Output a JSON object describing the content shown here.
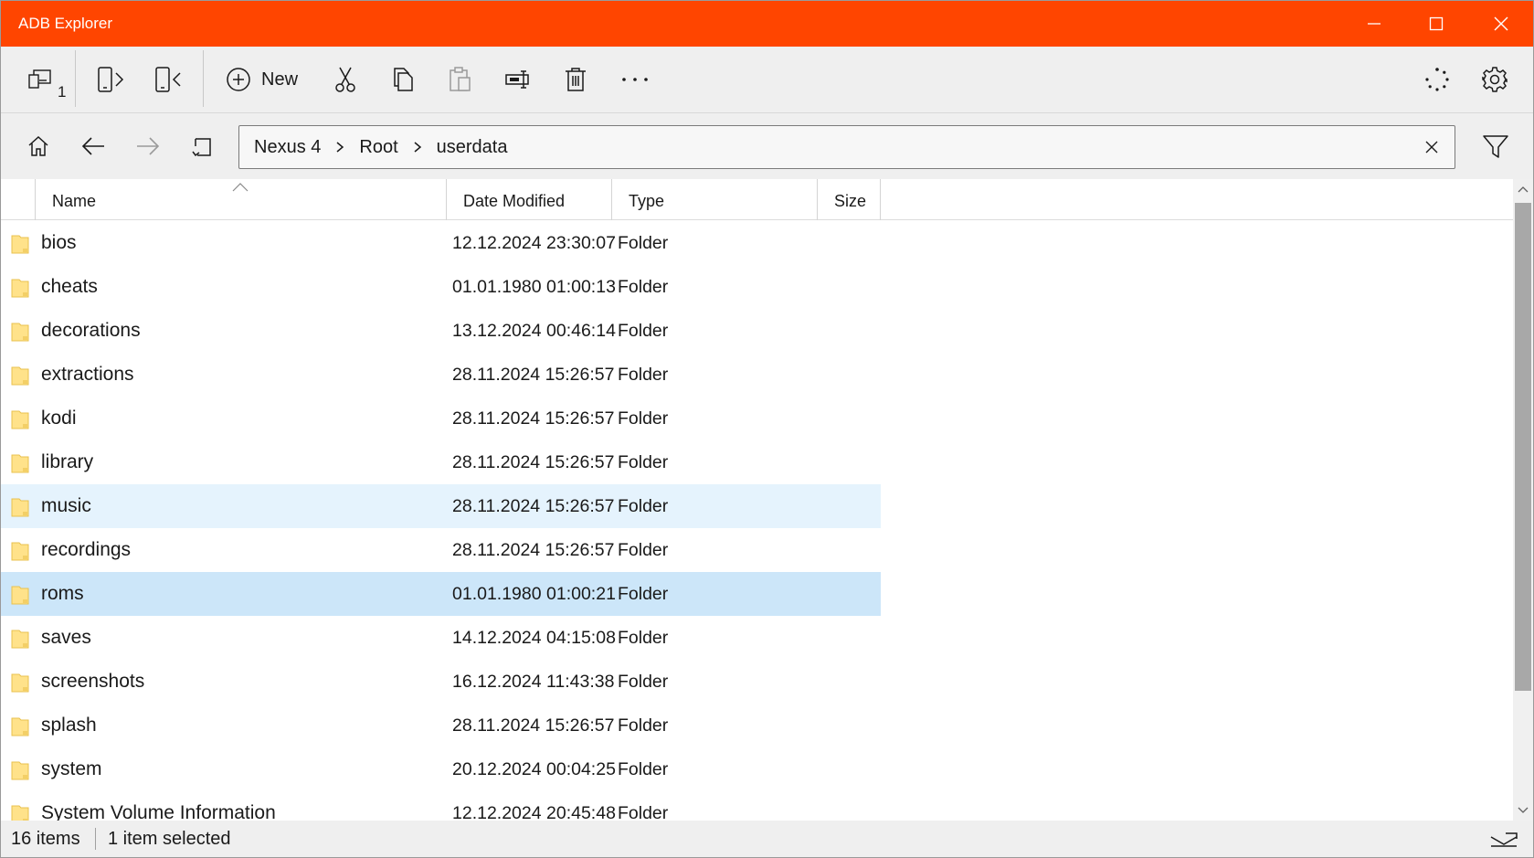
{
  "window": {
    "title": "ADB Explorer"
  },
  "toolbar": {
    "device_count": "1",
    "new_label": "New",
    "icons": [
      "devices-icon",
      "push-icon",
      "pull-icon",
      "new-icon",
      "cut-icon",
      "copy-icon",
      "paste-icon",
      "rename-icon",
      "delete-icon",
      "more-icon",
      "progress-icon",
      "gear-icon"
    ]
  },
  "nav": {
    "breadcrumbs": [
      "Nexus 4",
      "Root",
      "userdata"
    ]
  },
  "columns": {
    "name": "Name",
    "date": "Date Modified",
    "type": "Type",
    "size": "Size"
  },
  "files": [
    {
      "name": "bios",
      "date": "12.12.2024 23:30:07",
      "type": "Folder"
    },
    {
      "name": "cheats",
      "date": "01.01.1980 01:00:13",
      "type": "Folder"
    },
    {
      "name": "decorations",
      "date": "13.12.2024 00:46:14",
      "type": "Folder"
    },
    {
      "name": "extractions",
      "date": "28.11.2024 15:26:57",
      "type": "Folder"
    },
    {
      "name": "kodi",
      "date": "28.11.2024 15:26:57",
      "type": "Folder"
    },
    {
      "name": "library",
      "date": "28.11.2024 15:26:57",
      "type": "Folder"
    },
    {
      "name": "music",
      "date": "28.11.2024 15:26:57",
      "type": "Folder"
    },
    {
      "name": "recordings",
      "date": "28.11.2024 15:26:57",
      "type": "Folder"
    },
    {
      "name": "roms",
      "date": "01.01.1980 01:00:21",
      "type": "Folder"
    },
    {
      "name": "saves",
      "date": "14.12.2024 04:15:08",
      "type": "Folder"
    },
    {
      "name": "screenshots",
      "date": "16.12.2024 11:43:38",
      "type": "Folder"
    },
    {
      "name": "splash",
      "date": "28.11.2024 15:26:57",
      "type": "Folder"
    },
    {
      "name": "system",
      "date": "20.12.2024 00:04:25",
      "type": "Folder"
    },
    {
      "name": "System Volume Information",
      "date": "12.12.2024 20:45:48",
      "type": "Folder"
    }
  ],
  "status": {
    "item_count": "16 items",
    "selection": "1 item selected"
  },
  "colors": {
    "titlebar": "#ff4500",
    "hover_row": "#e5f3fd",
    "selected_row": "#cce6f9",
    "folder": "#ffe28a"
  }
}
